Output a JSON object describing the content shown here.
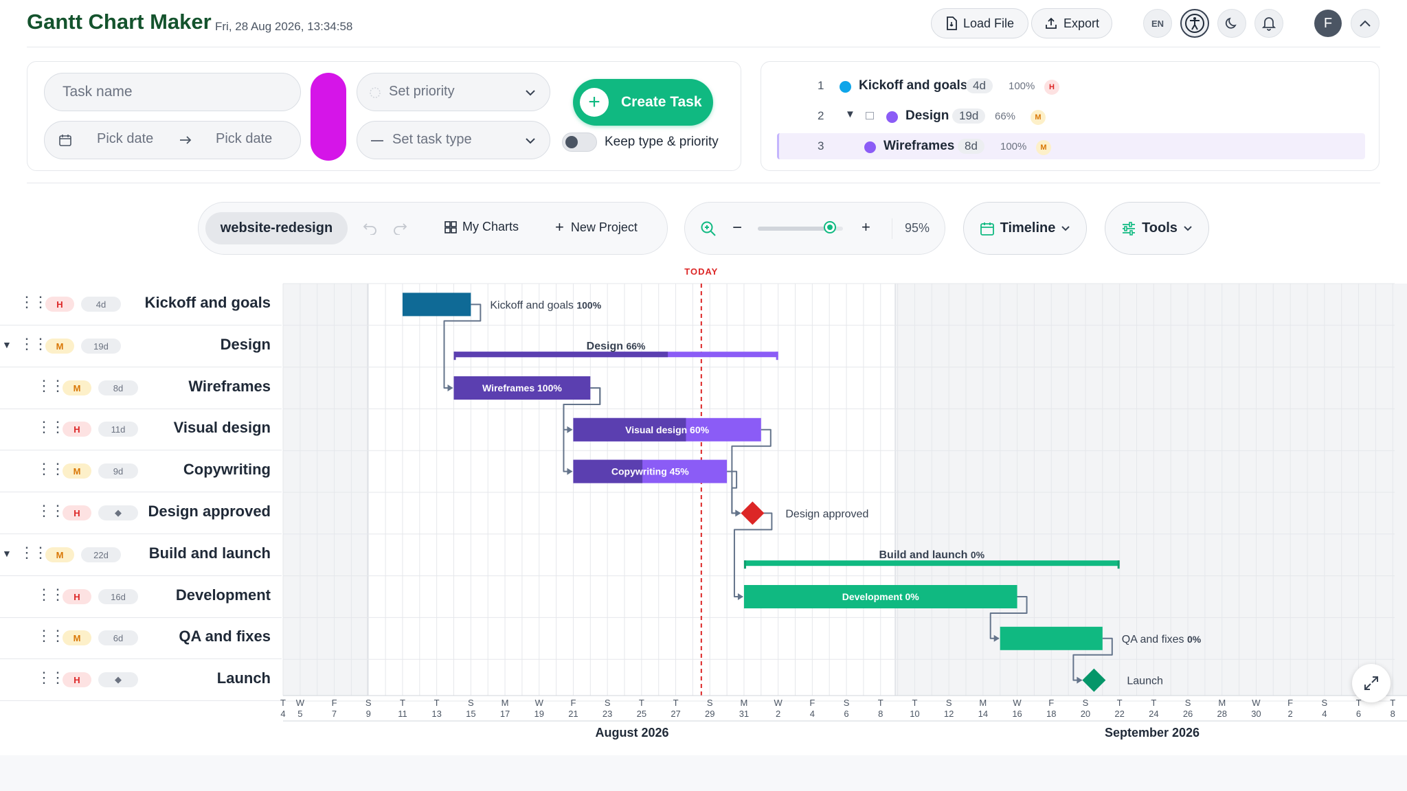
{
  "app": {
    "title": "Gantt Chart Maker",
    "datetime": "Fri, 28 Aug 2026, 13:34:58"
  },
  "header": {
    "load_label": "Load File",
    "export_label": "Export",
    "lang": "EN",
    "avatar_initial": "F"
  },
  "form": {
    "task_name_placeholder": "Task name",
    "start_date_placeholder": "Pick date",
    "end_date_placeholder": "Pick date",
    "color": "#d515e8",
    "priority_placeholder": "Set priority",
    "type_placeholder": "Set task type",
    "create_label": "Create Task",
    "keep_label": "Keep type & priority"
  },
  "task_list": [
    {
      "num": "1",
      "name": "Kickoff and goals",
      "duration": "4d",
      "progress": "100%",
      "priority": "H",
      "color": "#0ea5e9"
    },
    {
      "num": "2",
      "name": "Design",
      "duration": "19d",
      "progress": "66%",
      "priority": "M",
      "color": "#8b5cf6"
    },
    {
      "num": "3",
      "name": "Wireframes",
      "duration": "8d",
      "progress": "100%",
      "priority": "M",
      "color": "#8b5cf6"
    }
  ],
  "toolbar": {
    "project_name": "website-redesign",
    "my_charts_label": "My Charts",
    "new_project_label": "New Project",
    "zoom_value": "95%",
    "zoom_fraction": 0.85,
    "view_label": "Timeline",
    "tools_label": "Tools"
  },
  "rows": [
    {
      "name": "Kickoff and goals",
      "priority": "H",
      "duration": "4d",
      "group": false,
      "child": false
    },
    {
      "name": "Design",
      "priority": "M",
      "duration": "19d",
      "group": true,
      "child": false
    },
    {
      "name": "Wireframes",
      "priority": "M",
      "duration": "8d",
      "group": false,
      "child": true
    },
    {
      "name": "Visual design",
      "priority": "H",
      "duration": "11d",
      "group": false,
      "child": true
    },
    {
      "name": "Copywriting",
      "priority": "M",
      "duration": "9d",
      "group": false,
      "child": true
    },
    {
      "name": "Design approved",
      "priority": "H",
      "duration": "◆",
      "group": false,
      "child": true
    },
    {
      "name": "Build and launch",
      "priority": "M",
      "duration": "22d",
      "group": true,
      "child": false
    },
    {
      "name": "Development",
      "priority": "H",
      "duration": "16d",
      "group": false,
      "child": true
    },
    {
      "name": "QA and fixes",
      "priority": "M",
      "duration": "6d",
      "group": false,
      "child": true
    },
    {
      "name": "Launch",
      "priority": "H",
      "duration": "◆",
      "group": false,
      "child": true
    }
  ],
  "chart_data": {
    "type": "gantt",
    "today_label": "TODAY",
    "today": "2026-08-28",
    "tasks": [
      {
        "name": "Kickoff and goals",
        "start": "2026-08-11",
        "end": "2026-08-14",
        "progress": 100,
        "kind": "task",
        "color": "#0f6a96",
        "label": "Kickoff and goals",
        "pct": "100%"
      },
      {
        "name": "Design",
        "start": "2026-08-14",
        "end": "2026-09-01",
        "progress": 66,
        "kind": "summary",
        "color": "#8b5cf6",
        "label": "Design",
        "pct": "66%"
      },
      {
        "name": "Wireframes",
        "start": "2026-08-14",
        "end": "2026-08-21",
        "progress": 100,
        "kind": "task",
        "color": "#5b3fb0",
        "label": "Wireframes",
        "pct": "100%"
      },
      {
        "name": "Visual design",
        "start": "2026-08-21",
        "end": "2026-08-31",
        "progress": 60,
        "kind": "task",
        "color": "#8b5cf6",
        "label": "Visual design",
        "pct": "60%"
      },
      {
        "name": "Copywriting",
        "start": "2026-08-21",
        "end": "2026-08-29",
        "progress": 45,
        "kind": "task",
        "color": "#8b5cf6",
        "label": "Copywriting",
        "pct": "45%"
      },
      {
        "name": "Design approved",
        "start": "2026-08-31",
        "end": "2026-08-31",
        "progress": 0,
        "kind": "milestone",
        "color": "#dc2626",
        "label": "Design approved",
        "pct": ""
      },
      {
        "name": "Build and launch",
        "start": "2026-08-31",
        "end": "2026-09-21",
        "progress": 0,
        "kind": "summary",
        "color": "#10b981",
        "label": "Build and launch",
        "pct": "0%"
      },
      {
        "name": "Development",
        "start": "2026-08-31",
        "end": "2026-09-15",
        "progress": 0,
        "kind": "task",
        "color": "#10b981",
        "label": "Development",
        "pct": "0%"
      },
      {
        "name": "QA and fixes",
        "start": "2026-09-15",
        "end": "2026-09-20",
        "progress": 0,
        "kind": "task",
        "color": "#10b981",
        "label": "QA and fixes",
        "pct": "0%"
      },
      {
        "name": "Launch",
        "start": "2026-09-20",
        "end": "2026-09-20",
        "progress": 0,
        "kind": "milestone",
        "color": "#059669",
        "label": "Launch",
        "pct": ""
      }
    ],
    "dependencies": [
      [
        0,
        2
      ],
      [
        2,
        3
      ],
      [
        2,
        4
      ],
      [
        3,
        5
      ],
      [
        4,
        5
      ],
      [
        5,
        7
      ],
      [
        7,
        8
      ],
      [
        8,
        9
      ]
    ],
    "months": [
      "August 2026",
      "September 2026"
    ]
  }
}
